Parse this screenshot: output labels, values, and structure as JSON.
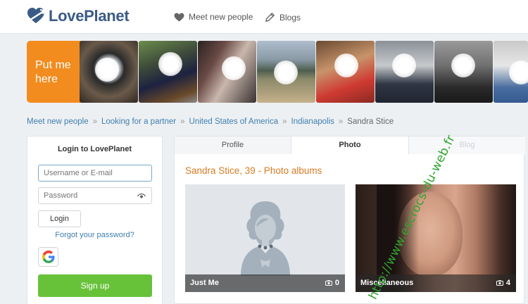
{
  "header": {
    "logo_text": "LovePlanet",
    "nav": {
      "meet_label": "Meet new people",
      "blogs_label": "Blogs"
    }
  },
  "strip": {
    "put_me_line1": "Put me",
    "put_me_line2": "here"
  },
  "breadcrumb": {
    "items": [
      "Meet new people",
      "Looking for a partner",
      "United States of America",
      "Indianapolis"
    ],
    "separator": "»",
    "current": "Sandra Stice"
  },
  "login": {
    "title": "Login to LovePlanet",
    "username_placeholder": "Username or E-mail",
    "password_placeholder": "Password",
    "login_label": "Login",
    "forgot_label": "Forgot your password?",
    "signup_label": "Sign up"
  },
  "main": {
    "tabs": [
      {
        "label": "Profile"
      },
      {
        "label": "Photo"
      },
      {
        "label": "Blog"
      }
    ],
    "albums_title": "Sandra Stice, 39 - Photo albums",
    "albums": [
      {
        "name": "Just Me",
        "count": "0"
      },
      {
        "name": "Miscellaneous",
        "count": "4"
      }
    ]
  },
  "watermark": "http://www.escrocs-du-web.fr",
  "colors": {
    "brand": "#3b5b86",
    "accent_orange": "#f28c1f",
    "link": "#3f7fb0",
    "signup_green": "#67c23a",
    "album_title": "#d97b21"
  },
  "icons": [
    "heart-icon",
    "pencil-icon",
    "eye-icon",
    "google-icon",
    "camera-icon",
    "logo-heart-icon"
  ]
}
